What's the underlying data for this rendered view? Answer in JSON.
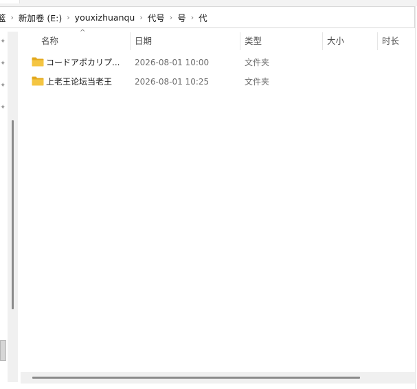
{
  "breadcrumb": {
    "items": [
      "篮",
      "新加卷 (E:)",
      "youxizhuanqu",
      "代号",
      "号",
      "代"
    ]
  },
  "columns": {
    "name": "名称",
    "date": "日期",
    "type": "类型",
    "size": "大小",
    "duration": "时长"
  },
  "files": [
    {
      "name": "コードアポカリプ...",
      "date": "2026-08-01 10:00",
      "type": "文件夹",
      "icon": "folder-icon"
    },
    {
      "name": "上老王论坛当老王",
      "date": "2026-08-01 10:25",
      "type": "文件夹",
      "icon": "folder-icon"
    }
  ],
  "colors": {
    "folder": "#f4c542",
    "folder_dark": "#e3a91f",
    "header_text": "#4d4d4d",
    "secondary_text": "#6d6d6d",
    "scroll_thumb": "#8a8a8a"
  }
}
